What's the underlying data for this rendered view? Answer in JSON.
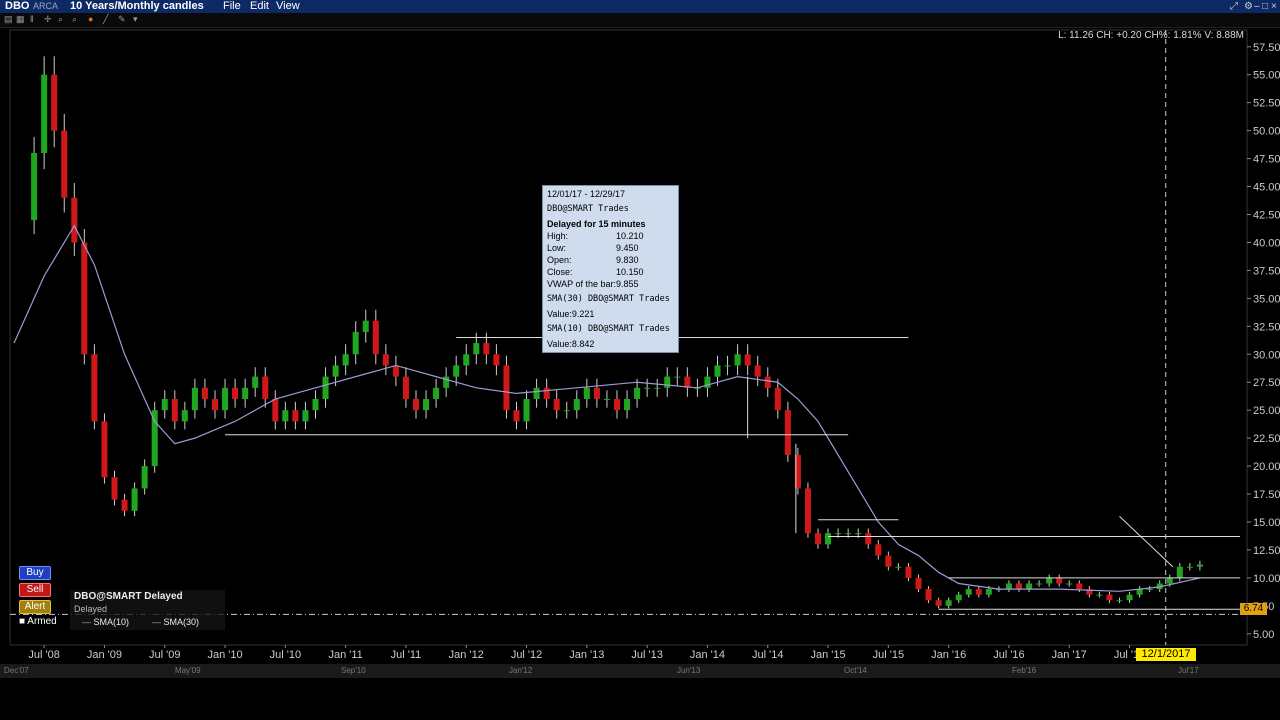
{
  "title_bar": {
    "symbol": "DBO",
    "exchange": "ARCA",
    "period": "10 Years/Monthly candles",
    "menu": [
      "File",
      "Edit",
      "View"
    ]
  },
  "info_line": "L: 11.26 CH: +0.20 CH%: 1.81% V: 8.88M",
  "tooltip": {
    "date_range": "12/01/17 - 12/29/17",
    "source": "DBO@SMART  Trades",
    "delay": "Delayed for 15 minutes",
    "high_label": "High:",
    "high": "10.210",
    "low_label": "Low:",
    "low": "9.450",
    "open_label": "Open:",
    "open": "9.830",
    "close_label": "Close:",
    "close": "10.150",
    "vwap": "VWAP of the bar:9.855",
    "sma30_source": "SMA(30)  DBO@SMART  Trades",
    "sma30_value": "Value:9.221",
    "sma10_source": "SMA(10)  DBO@SMART  Trades",
    "sma10_value": "Value:8.842"
  },
  "side_buttons": {
    "buy": "Buy",
    "sell": "Sell",
    "alert": "Alert",
    "armed": "Armed"
  },
  "legend": {
    "title": "DBO@SMART Delayed",
    "status": "Delayed",
    "sma10": "SMA(10)",
    "sma30": "SMA(30)"
  },
  "current_price": "6.74",
  "cursor_date": "12/1/2017",
  "colors": {
    "up": "#1fa81f",
    "down": "#d01818",
    "sma": "#9c9cd8",
    "titlebar": "#0e2a66"
  },
  "bottom_bar_labels": [
    "Dec'07",
    "May'09",
    "Sep'10",
    "Jan'12",
    "Jun'13",
    "Oct'14",
    "Feb'16",
    "Jul'17"
  ],
  "chart_data": {
    "type": "candlestick",
    "y_ticks": [
      "57.50",
      "55.00",
      "52.50",
      "50.00",
      "47.50",
      "45.00",
      "42.50",
      "40.00",
      "37.50",
      "35.00",
      "32.50",
      "30.00",
      "27.50",
      "25.00",
      "22.50",
      "20.00",
      "17.50",
      "15.00",
      "12.50",
      "10.00",
      "7.50",
      "5.00"
    ],
    "ylim": [
      4,
      59
    ],
    "x_labels": [
      "Jul '08",
      "Jan '09",
      "Jul '09",
      "Jan '10",
      "Jul '10",
      "Jan '11",
      "Jul '11",
      "Jan '12",
      "Jul '12",
      "Jan '13",
      "Jul '13",
      "Jan '14",
      "Jul '14",
      "Jan '15",
      "Jul '15",
      "Jan '16",
      "Jul '16",
      "Jan '17",
      "Jul '17"
    ],
    "close_path": [
      [
        0,
        42
      ],
      [
        2,
        48
      ],
      [
        3,
        55
      ],
      [
        4,
        50
      ],
      [
        5,
        44
      ],
      [
        6,
        40
      ],
      [
        7,
        30
      ],
      [
        8,
        24
      ],
      [
        9,
        19
      ],
      [
        10,
        17
      ],
      [
        11,
        16
      ],
      [
        12,
        18
      ],
      [
        13,
        20
      ],
      [
        14,
        25
      ],
      [
        15,
        26
      ],
      [
        16,
        24
      ],
      [
        17,
        25
      ],
      [
        18,
        27
      ],
      [
        19,
        26
      ],
      [
        20,
        25
      ],
      [
        21,
        27
      ],
      [
        22,
        26
      ],
      [
        23,
        27
      ],
      [
        24,
        28
      ],
      [
        25,
        26
      ],
      [
        26,
        24
      ],
      [
        27,
        25
      ],
      [
        28,
        24
      ],
      [
        29,
        25
      ],
      [
        30,
        26
      ],
      [
        31,
        28
      ],
      [
        32,
        29
      ],
      [
        33,
        30
      ],
      [
        34,
        32
      ],
      [
        35,
        33
      ],
      [
        36,
        30
      ],
      [
        37,
        29
      ],
      [
        38,
        28
      ],
      [
        39,
        26
      ],
      [
        40,
        25
      ],
      [
        41,
        26
      ],
      [
        42,
        27
      ],
      [
        43,
        28
      ],
      [
        44,
        29
      ],
      [
        45,
        30
      ],
      [
        46,
        31
      ],
      [
        47,
        30
      ],
      [
        48,
        29
      ],
      [
        49,
        25
      ],
      [
        50,
        24
      ],
      [
        51,
        26
      ],
      [
        52,
        27
      ],
      [
        53,
        26
      ],
      [
        54,
        25
      ],
      [
        55,
        25
      ],
      [
        56,
        26
      ],
      [
        57,
        27
      ],
      [
        58,
        26
      ],
      [
        59,
        26
      ],
      [
        60,
        25
      ],
      [
        61,
        26
      ],
      [
        62,
        27
      ],
      [
        63,
        27
      ],
      [
        64,
        27
      ],
      [
        65,
        28
      ],
      [
        66,
        28
      ],
      [
        67,
        27
      ],
      [
        68,
        27
      ],
      [
        69,
        28
      ],
      [
        70,
        29
      ],
      [
        71,
        29
      ],
      [
        72,
        30
      ],
      [
        73,
        29
      ],
      [
        74,
        28
      ],
      [
        75,
        27
      ],
      [
        76,
        25
      ],
      [
        77,
        21
      ],
      [
        78,
        18
      ],
      [
        79,
        14
      ],
      [
        80,
        13
      ],
      [
        81,
        14
      ],
      [
        82,
        14
      ],
      [
        83,
        14
      ],
      [
        84,
        14
      ],
      [
        85,
        13
      ],
      [
        86,
        12
      ],
      [
        87,
        11
      ],
      [
        88,
        11
      ],
      [
        89,
        10
      ],
      [
        90,
        9
      ],
      [
        91,
        8
      ],
      [
        92,
        7.5
      ],
      [
        93,
        8
      ],
      [
        94,
        8.5
      ],
      [
        95,
        9
      ],
      [
        96,
        8.5
      ],
      [
        97,
        9
      ],
      [
        98,
        9
      ],
      [
        99,
        9.5
      ],
      [
        100,
        9
      ],
      [
        101,
        9.5
      ],
      [
        102,
        9.5
      ],
      [
        103,
        10
      ],
      [
        104,
        9.5
      ],
      [
        105,
        9.5
      ],
      [
        106,
        9
      ],
      [
        107,
        8.5
      ],
      [
        108,
        8.5
      ],
      [
        109,
        8
      ],
      [
        110,
        8
      ],
      [
        111,
        8.5
      ],
      [
        112,
        9
      ],
      [
        113,
        9
      ],
      [
        114,
        9.5
      ],
      [
        115,
        10
      ],
      [
        116,
        11
      ],
      [
        117,
        11
      ],
      [
        118,
        11.2
      ]
    ],
    "sma30_path": [
      [
        0,
        31
      ],
      [
        3,
        37
      ],
      [
        6,
        41.5
      ],
      [
        8,
        38
      ],
      [
        11,
        30
      ],
      [
        14,
        24
      ],
      [
        16,
        22
      ],
      [
        18,
        22.5
      ],
      [
        22,
        24
      ],
      [
        26,
        26
      ],
      [
        30,
        27
      ],
      [
        34,
        28
      ],
      [
        38,
        29
      ],
      [
        42,
        28
      ],
      [
        46,
        27
      ],
      [
        50,
        26.5
      ],
      [
        56,
        27
      ],
      [
        62,
        27.5
      ],
      [
        68,
        27
      ],
      [
        72,
        28
      ],
      [
        76,
        27.5
      ],
      [
        78,
        26
      ],
      [
        80,
        24
      ],
      [
        82,
        21
      ],
      [
        84,
        18
      ],
      [
        86,
        15
      ],
      [
        88,
        13
      ],
      [
        90,
        12
      ],
      [
        92,
        10.5
      ],
      [
        94,
        9.5
      ],
      [
        98,
        9
      ],
      [
        104,
        9
      ],
      [
        110,
        8.8
      ],
      [
        114,
        9.2
      ],
      [
        118,
        10
      ]
    ],
    "horizontal_lines": [
      {
        "y": 31.5,
        "x_from": 44,
        "x_to": 89
      },
      {
        "y": 22.8,
        "x_from": 21,
        "x_to": 83
      },
      {
        "y": 15.2,
        "x_from": 80,
        "x_to": 88
      },
      {
        "y": 13.7,
        "x_from": 81,
        "x_to": 122
      },
      {
        "y": 10.0,
        "x_from": 93,
        "x_to": 122
      },
      {
        "y": 7.2,
        "x_from": 92,
        "x_to": 122
      }
    ]
  }
}
